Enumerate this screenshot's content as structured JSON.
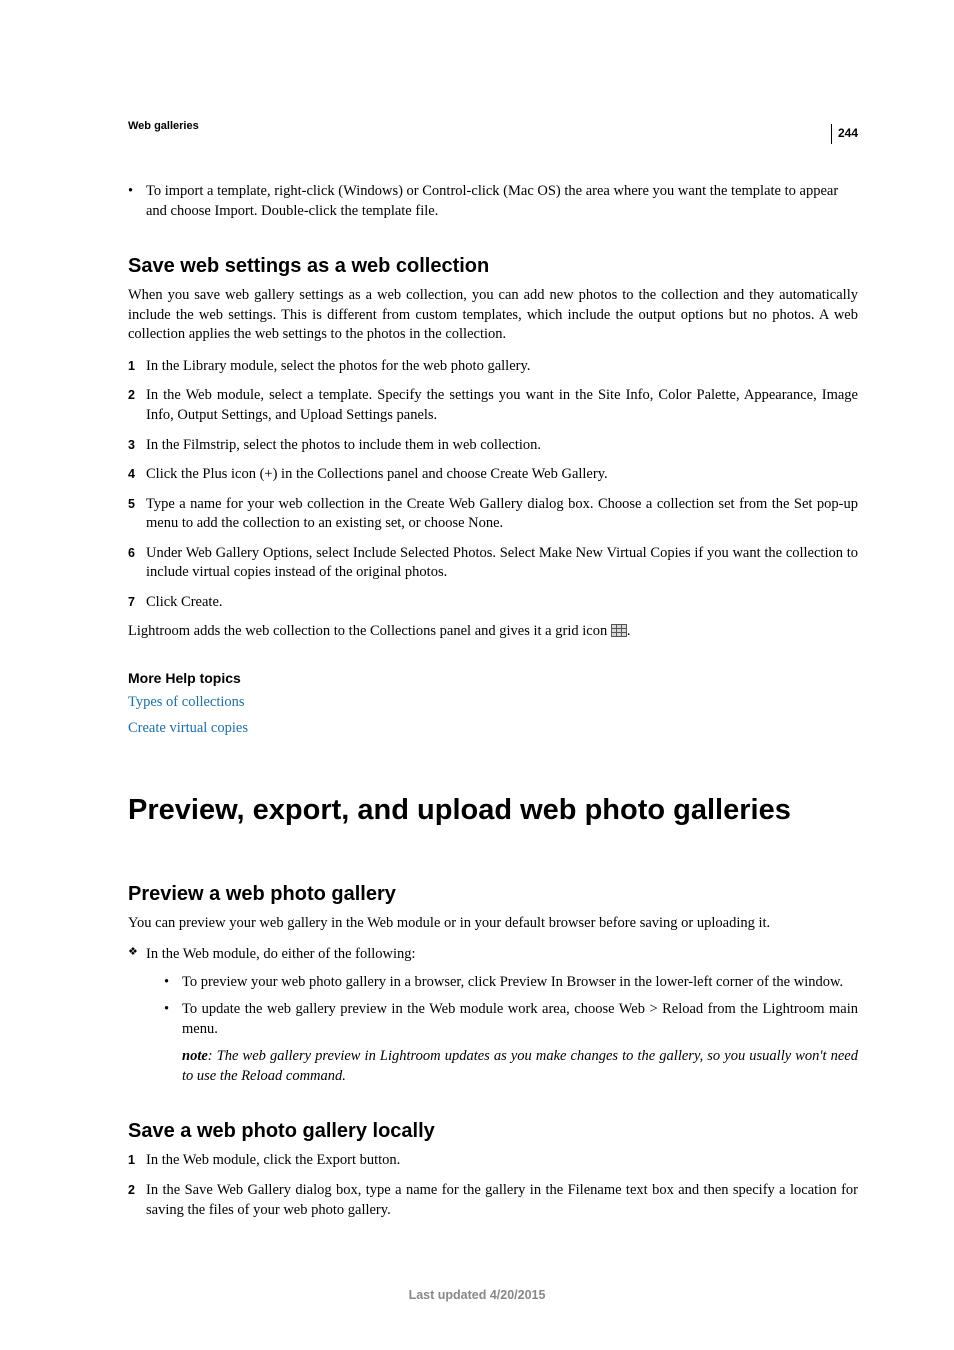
{
  "header": {
    "section": "Web galleries",
    "page_number": "244"
  },
  "intro_bullet": "To import a template, right-click (Windows) or Control-click (Mac OS) the area where you want the template to appear and choose Import. Double-click the template file.",
  "section1": {
    "heading": "Save web settings as a web collection",
    "intro": "When you save web gallery settings as a web collection, you can add new photos to the collection and they automatically include the web settings. This is different from custom templates, which include the output options but no photos. A web collection applies the web settings to the photos in the collection.",
    "steps": [
      "In the Library module, select the photos for the web photo gallery.",
      "In the Web module, select a template. Specify the settings you want in the Site Info, Color Palette, Appearance, Image Info, Output Settings, and Upload Settings panels.",
      "In the Filmstrip, select the photos to include them in web collection.",
      "Click the Plus icon (+) in the Collections panel and choose Create Web Gallery.",
      "Type a name for your web collection in the Create Web Gallery dialog box. Choose a collection set from the Set pop-up menu to add the collection to an existing set, or choose None.",
      "Under Web Gallery Options, select Include Selected Photos. Select Make New Virtual Copies if you want the collection to include virtual copies instead of the original photos.",
      "Click Create."
    ],
    "closing_prefix": "Lightroom adds the web collection to the Collections panel and gives it a grid icon ",
    "closing_suffix": "."
  },
  "more_help": {
    "heading": "More Help topics",
    "links": [
      "Types of collections",
      "Create virtual copies"
    ]
  },
  "section2": {
    "title": "Preview, export, and upload web photo galleries",
    "sub_a": {
      "heading": "Preview a web photo gallery",
      "intro": "You can preview your web gallery in the Web module or in your default browser before saving or uploading it.",
      "lead": "In the Web module, do either of the following:",
      "bullets": [
        "To preview your web photo gallery in a browser, click Preview In Browser in the lower-left corner of the window.",
        "To update the web gallery preview in the Web module work area, choose Web > Reload from the Lightroom main menu."
      ],
      "note_label": "note",
      "note_text": ": The web gallery preview in Lightroom updates as you make changes to the gallery, so you usually won't need to use the Reload command."
    },
    "sub_b": {
      "heading": "Save a web photo gallery locally",
      "steps": [
        "In the Web module, click the Export button.",
        "In the Save Web Gallery dialog box, type a name for the gallery in the Filename text box and then specify a location for saving the files of your web photo gallery."
      ]
    }
  },
  "footer": "Last updated 4/20/2015"
}
